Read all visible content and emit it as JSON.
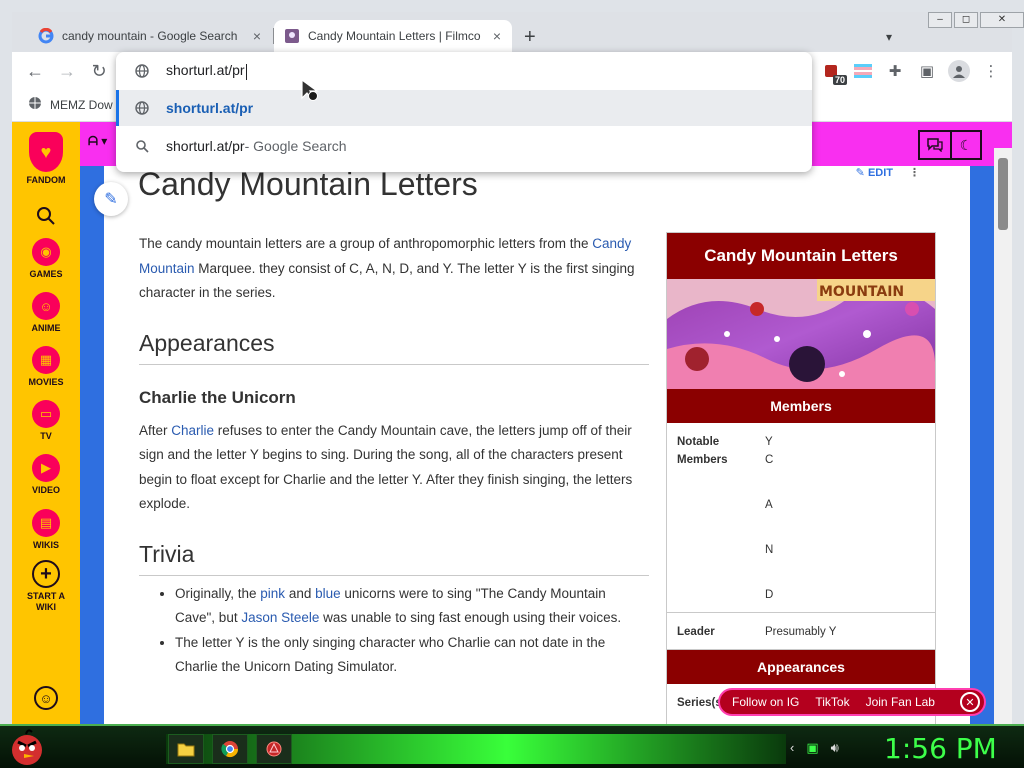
{
  "browser": {
    "tabs": [
      {
        "title": "candy mountain - Google Search",
        "favicon": "google-icon"
      },
      {
        "title": "Candy Mountain Letters | Filmco",
        "favicon": "fandom-page-icon"
      }
    ],
    "new_tab": "+",
    "close_glyph": "×",
    "window_buttons": [
      "–",
      "◻",
      "✕"
    ],
    "extension_badge": "70",
    "bookmark": "MEMZ Dow"
  },
  "omnibox": {
    "input": "shorturl.at/pr",
    "suggestions": [
      {
        "text": "shorturl.at/pr",
        "suffix": "",
        "icon": "globe-icon"
      },
      {
        "text": "shorturl.at/pr",
        "suffix": " - Google Search",
        "icon": "search-icon"
      }
    ]
  },
  "rail": {
    "items": [
      "FANDOM",
      "GAMES",
      "ANIME",
      "MOVIES",
      "TV",
      "VIDEO",
      "WIKIS",
      "START A WIKI"
    ]
  },
  "article": {
    "title": "Candy Mountain Letters",
    "edit_label": "EDIT",
    "intro_prefix": "The candy mountain letters are a group of anthropomorphic letters from the ",
    "intro_link": "Candy Mountain",
    "intro_suffix": " Marquee. they consist of C, A, N, D, and Y. The letter Y is the first singing character in the series.",
    "h2_appearances": "Appearances",
    "h3_charlie": "Charlie the Unicorn",
    "p2_prefix": "After ",
    "p2_link": "Charlie",
    "p2_suffix": " refuses to enter the Candy Mountain cave, the letters jump off of their sign and the letter Y begins to sing. During the song, all of the characters present begin to float except for Charlie and the letter Y. After they finish singing, the letters explode.",
    "h2_trivia": "Trivia",
    "trivia1_a": "Originally, the ",
    "trivia1_pink": "pink",
    "trivia1_b": " and ",
    "trivia1_blue": "blue",
    "trivia1_c": " unicorns were to sing \"The Candy Mountain Cave\", but ",
    "trivia1_jason": "Jason Steele",
    "trivia1_d": " was unable to sing fast enough using their voices.",
    "trivia2": "The letter Y is the only singing character who Charlie can not date in the Charlie the Unicorn Dating Simulator."
  },
  "infobox": {
    "title": "Candy Mountain Letters",
    "image_text": "MOUNTAIN",
    "members_header": "Members",
    "notable_label": "Notable Members",
    "members": [
      "Y",
      "C",
      "A",
      "N",
      "D"
    ],
    "leader_label": "Leader",
    "leader_value": "Presumably Y",
    "appearances_header": "Appearances",
    "series_label": "Series(s"
  },
  "fanlab": {
    "items": [
      "Follow on IG",
      "TikTok",
      "Join Fan Lab"
    ]
  },
  "taskbar": {
    "clock": "1:56 PM"
  },
  "colors": {
    "fandom_yellow": "#ffc500",
    "community_pink": "#f92ff0",
    "infobox_red": "#8b0000",
    "clock_green": "#3dff4a"
  }
}
